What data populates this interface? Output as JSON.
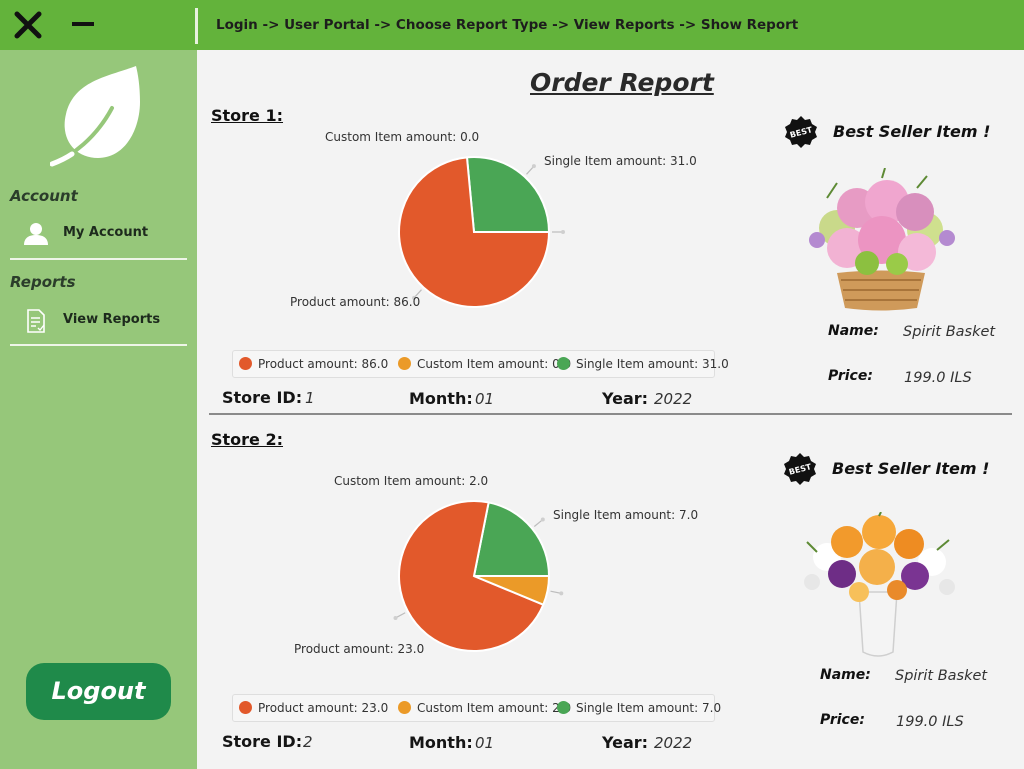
{
  "window": {
    "breadcrumb": "Login -> User Portal -> Choose Report Type -> View Reports -> Show Report"
  },
  "sidebar": {
    "account_heading": "Account",
    "my_account_label": "My Account",
    "reports_heading": "Reports",
    "view_reports_label": "View Reports",
    "logout_label": "Logout"
  },
  "colors": {
    "topbar": "#63b33b",
    "sidebar": "#96c77a",
    "logout": "#1f8a4a",
    "product": "#e2592b",
    "custom": "#eb9a28",
    "single": "#4aa655"
  },
  "page": {
    "title": "Order Report"
  },
  "stores": [
    {
      "label": "Store 1:",
      "legend_product": "Product amount: 86.0",
      "legend_custom": "Custom Item amount: 0.0",
      "legend_single": "Single Item amount: 31.0",
      "callout_product": "Product amount: 86.0",
      "callout_custom": "Custom Item amount: 0.0",
      "callout_single": "Single Item amount: 31.0",
      "store_id_key": "Store ID:",
      "store_id": "1",
      "month_key": "Month:",
      "month": "01",
      "year_key": "Year:",
      "year": "2022",
      "best_seller_label": "Best Seller Item !",
      "badge_text": "BEST",
      "name_key": "Name:",
      "name": "Spirit Basket",
      "price_key": "Price:",
      "price": "199.0 ILS"
    },
    {
      "label": "Store 2:",
      "legend_product": "Product amount: 23.0",
      "legend_custom": "Custom Item amount: 2.0",
      "legend_single": "Single Item amount: 7.0",
      "callout_product": "Product amount: 23.0",
      "callout_custom": "Custom Item amount: 2.0",
      "callout_single": "Single Item amount: 7.0",
      "store_id_key": "Store ID:",
      "store_id": "2",
      "month_key": "Month:",
      "month": "01",
      "year_key": "Year:",
      "year": "2022",
      "best_seller_label": "Best Seller Item !",
      "badge_text": "BEST",
      "name_key": "Name:",
      "name": "Spirit Basket",
      "price_key": "Price:",
      "price": "199.0 ILS"
    }
  ],
  "chart_data": [
    {
      "type": "pie",
      "categories": [
        "Product amount",
        "Custom Item amount",
        "Single Item amount"
      ],
      "values": [
        86.0,
        0.0,
        31.0
      ],
      "legend": "bottom"
    },
    {
      "type": "pie",
      "categories": [
        "Product amount",
        "Custom Item amount",
        "Single Item amount"
      ],
      "values": [
        23.0,
        2.0,
        7.0
      ],
      "legend": "bottom"
    }
  ]
}
